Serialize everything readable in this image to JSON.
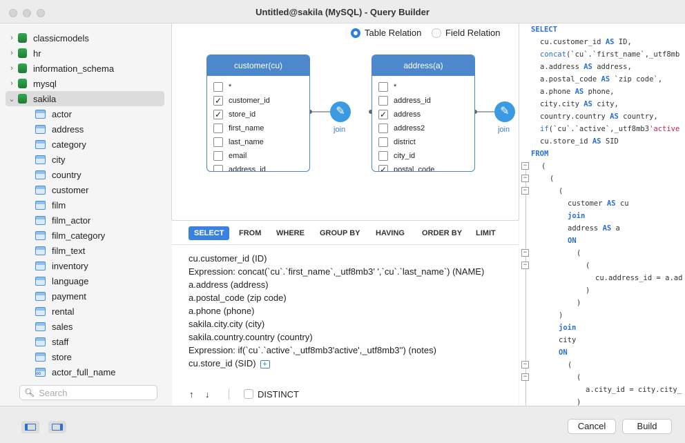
{
  "window": {
    "title": "Untitled@sakila (MySQL) - Query Builder"
  },
  "sidebar": {
    "databases": [
      {
        "name": "classicmodels",
        "expanded": false
      },
      {
        "name": "hr",
        "expanded": false
      },
      {
        "name": "information_schema",
        "expanded": false
      },
      {
        "name": "mysql",
        "expanded": false
      },
      {
        "name": "sakila",
        "expanded": true
      }
    ],
    "tables": [
      "actor",
      "address",
      "category",
      "city",
      "country",
      "customer",
      "film",
      "film_actor",
      "film_category",
      "film_text",
      "inventory",
      "language",
      "payment",
      "rental",
      "sales",
      "staff",
      "store"
    ],
    "views": [
      "actor_full_name"
    ],
    "search_placeholder": "Search"
  },
  "canvas": {
    "relation_options": [
      {
        "label": "Table Relation",
        "selected": true
      },
      {
        "label": "Field Relation",
        "selected": false
      }
    ],
    "tables": [
      {
        "title": "customer(cu)",
        "columns": [
          {
            "name": "*",
            "checked": false
          },
          {
            "name": "customer_id",
            "checked": true
          },
          {
            "name": "store_id",
            "checked": true
          },
          {
            "name": "first_name",
            "checked": false
          },
          {
            "name": "last_name",
            "checked": false
          },
          {
            "name": "email",
            "checked": false
          },
          {
            "name": "address_id",
            "checked": false
          }
        ]
      },
      {
        "title": "address(a)",
        "columns": [
          {
            "name": "*",
            "checked": false
          },
          {
            "name": "address_id",
            "checked": false
          },
          {
            "name": "address",
            "checked": true
          },
          {
            "name": "address2",
            "checked": false
          },
          {
            "name": "district",
            "checked": false
          },
          {
            "name": "city_id",
            "checked": false
          },
          {
            "name": "postal_code",
            "checked": true
          }
        ]
      }
    ],
    "join_label": "join"
  },
  "clause_tabs": [
    "SELECT",
    "FROM",
    "WHERE",
    "GROUP BY",
    "HAVING",
    "ORDER BY",
    "LIMIT"
  ],
  "active_tab": "SELECT",
  "select_fields": [
    {
      "prefix": "",
      "text": "cu.customer_id  (ID)"
    },
    {
      "prefix": "Expression:",
      "text": " concat(`cu`.`first_name`,_utf8mb3' ',`cu`.`last_name`)  (NAME)"
    },
    {
      "prefix": "",
      "text": "a.address  (address)"
    },
    {
      "prefix": "",
      "text": "a.postal_code  (zip code)"
    },
    {
      "prefix": "",
      "text": "a.phone  (phone)"
    },
    {
      "prefix": "",
      "text": "sakila.city.city  (city)"
    },
    {
      "prefix": "",
      "text": "sakila.country.country  (country)"
    },
    {
      "prefix": "Expression:",
      "text": " if(`cu`.`active`,_utf8mb3'active',_utf8mb3'')  (notes)"
    },
    {
      "prefix": "",
      "text": "cu.store_id  (SID)"
    }
  ],
  "field_toolbar": {
    "up": "↑",
    "down": "↓",
    "distinct_label": "DISTINCT"
  },
  "sql": {
    "kw_select": "SELECT",
    "l1": "cu.customer_id ",
    "l1_as": "AS",
    "l1_b": " ID,",
    "l2_fn": "concat",
    "l2": "(`cu`.`first_name`,_utf8mb",
    "l3": "a.address ",
    "l3_as": "AS",
    "l3_b": " address,",
    "l4": "a.postal_code ",
    "l4_as": "AS",
    "l4_b": " `zip code`,",
    "l5": "a.phone ",
    "l5_as": "AS",
    "l5_b": " phone,",
    "l6": "city.city ",
    "l6_as": "AS",
    "l6_b": " city,",
    "l7": "country.country ",
    "l7_as": "AS",
    "l7_b": " country,",
    "l8_fn": "if",
    "l8": "(`cu`.`active`,_utf8mb3",
    "l8_str": "'active",
    "l9": "cu.store_id ",
    "l9_as": "AS",
    "l9_b": " SID",
    "kw_from": "FROM",
    "p1": "(",
    "p2": "(",
    "p3": "(",
    "t1": "customer ",
    "t1_as": "AS",
    "t1_b": " cu",
    "kw_join1": "join",
    "t2": "address ",
    "t2_as": "AS",
    "t2_b": " a",
    "kw_on1": "ON",
    "p4": "(",
    "p5": "(",
    "c1": "cu.address_id = a.ad",
    "p6": ")",
    "p7": ")",
    "p8": ")",
    "kw_join2": "join",
    "t3": "city",
    "kw_on2": "ON",
    "p9": "(",
    "p10": "(",
    "c2": "a.city_id = city.city_",
    "p11": ")"
  },
  "bottom": {
    "cancel_label": "Cancel",
    "build_label": "Build"
  }
}
